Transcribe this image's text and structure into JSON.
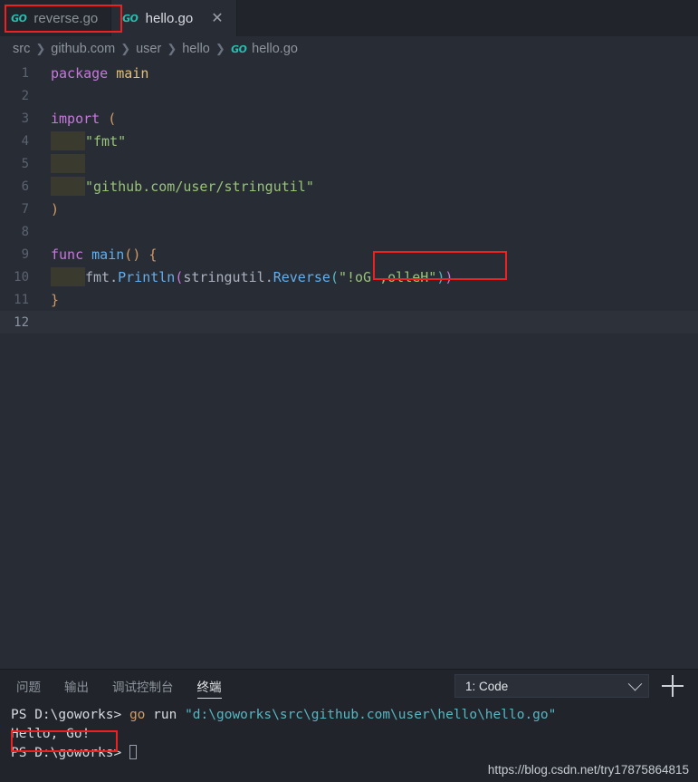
{
  "window": {
    "theme_bg": "#282c34",
    "chrome_bg": "#21252b",
    "accent_red": "#ee2020"
  },
  "tabs": [
    {
      "label": "reverse.go",
      "icon": "go-file-icon",
      "active": false,
      "closable": false,
      "highlighted": true
    },
    {
      "label": "hello.go",
      "icon": "go-file-icon",
      "active": true,
      "closable": true,
      "highlighted": false
    }
  ],
  "tab_close_glyph": "✕",
  "go_icon_text": "GO",
  "breadcrumb": {
    "separator": "❯",
    "items": [
      "src",
      "github.com",
      "user",
      "hello"
    ],
    "file": "hello.go",
    "file_icon": "go-file-icon"
  },
  "editor": {
    "language": "go",
    "current_line": 12,
    "lines": [
      {
        "n": "1",
        "tokens": [
          {
            "t": "package ",
            "c": "kw"
          },
          {
            "t": "main",
            "c": "pkg"
          }
        ]
      },
      {
        "n": "2",
        "tokens": []
      },
      {
        "n": "3",
        "tokens": [
          {
            "t": "import ",
            "c": "kw"
          },
          {
            "t": "(",
            "c": "par1"
          }
        ]
      },
      {
        "n": "4",
        "tokens": [
          {
            "t": "\t",
            "c": "indent"
          },
          {
            "t": "\"fmt\"",
            "c": "str"
          }
        ]
      },
      {
        "n": "5",
        "tokens": [
          {
            "t": "\t",
            "c": "indent"
          }
        ]
      },
      {
        "n": "6",
        "tokens": [
          {
            "t": "\t",
            "c": "indent"
          },
          {
            "t": "\"github.com/user/stringutil\"",
            "c": "str"
          }
        ]
      },
      {
        "n": "7",
        "tokens": [
          {
            "t": ")",
            "c": "par1"
          }
        ]
      },
      {
        "n": "8",
        "tokens": []
      },
      {
        "n": "9",
        "tokens": [
          {
            "t": "func ",
            "c": "kw"
          },
          {
            "t": "main",
            "c": "id"
          },
          {
            "t": "(",
            "c": "par1"
          },
          {
            "t": ")",
            "c": "par1"
          },
          {
            "t": " ",
            "c": "plain"
          },
          {
            "t": "{",
            "c": "par1"
          }
        ]
      },
      {
        "n": "10",
        "tokens": [
          {
            "t": "\t",
            "c": "indent"
          },
          {
            "t": "fmt",
            "c": "plain"
          },
          {
            "t": ".",
            "c": "punct"
          },
          {
            "t": "Println",
            "c": "fn"
          },
          {
            "t": "(",
            "c": "par2"
          },
          {
            "t": "stringutil",
            "c": "plain"
          },
          {
            "t": ".",
            "c": "punct"
          },
          {
            "t": "Reverse",
            "c": "fn"
          },
          {
            "t": "(",
            "c": "par3"
          },
          {
            "t": "\"!oG ,olleH\"",
            "c": "str"
          },
          {
            "t": ")",
            "c": "par3"
          },
          {
            "t": ")",
            "c": "par2"
          }
        ]
      },
      {
        "n": "11",
        "tokens": [
          {
            "t": "}",
            "c": "par1"
          }
        ]
      },
      {
        "n": "12",
        "tokens": []
      }
    ]
  },
  "panel": {
    "tabs": [
      {
        "label": "问题",
        "active": false
      },
      {
        "label": "输出",
        "active": false
      },
      {
        "label": "调试控制台",
        "active": false
      },
      {
        "label": "终端",
        "active": true
      }
    ],
    "terminal_selector": {
      "value": "1: Code",
      "chevron": "chevron-down-icon"
    },
    "new_terminal_label": "+",
    "terminal_lines": [
      [
        {
          "t": "PS D:\\goworks> ",
          "c": "t-prompt"
        },
        {
          "t": "go",
          "c": "t-cmd"
        },
        {
          "t": " run ",
          "c": "t-arg"
        },
        {
          "t": "\"d:\\goworks\\src\\github.com\\user\\hello\\hello.go\"",
          "c": "t-path"
        }
      ],
      [
        {
          "t": "Hello, Go!",
          "c": "t-out"
        }
      ],
      [
        {
          "t": "PS D:\\goworks> ",
          "c": "t-prompt"
        },
        {
          "t": "",
          "c": "cursor"
        }
      ]
    ]
  },
  "watermark": "https://blog.csdn.net/try17875864815"
}
